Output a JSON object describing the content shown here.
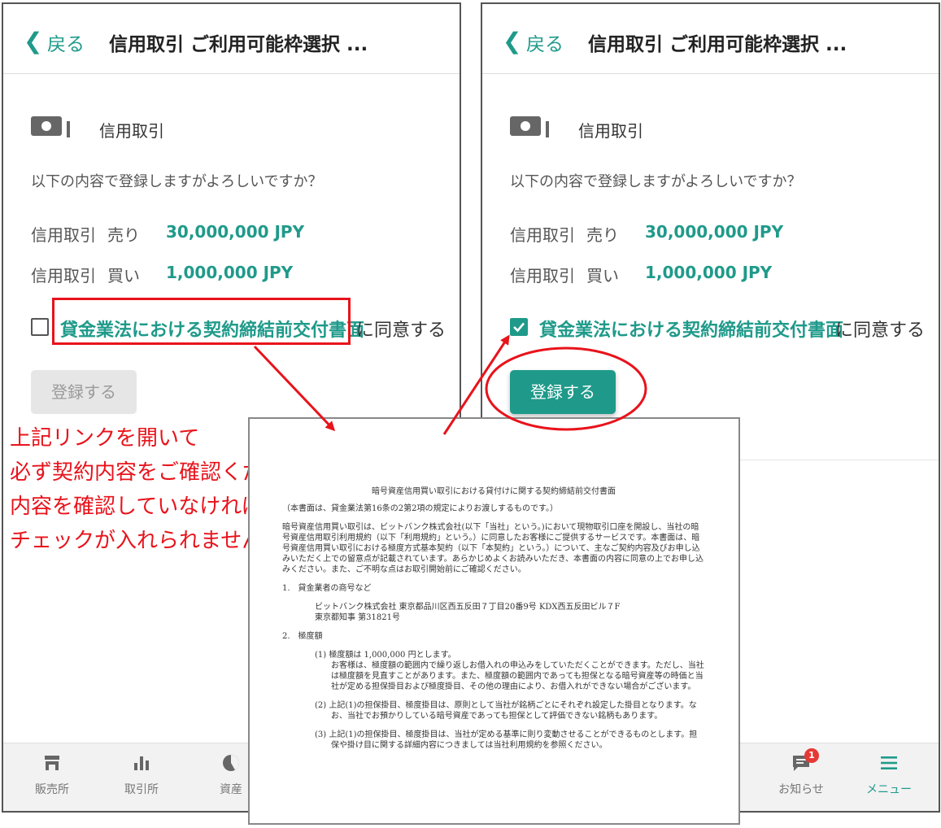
{
  "header": {
    "back_label": "戻る",
    "title": "信用取引 ご利用可能枠選択 ..."
  },
  "section": {
    "label": "信用取引",
    "icon": "cash-icon"
  },
  "confirm_text": "以下の内容で登録しますがよろしいですか？",
  "lines": {
    "sell_label": "信用取引",
    "sell_side": "売り",
    "sell_value": "30,000,000 JPY",
    "buy_label": "信用取引",
    "buy_side": "買い",
    "buy_value": "1,000,000 JPY"
  },
  "agreement": {
    "link_text": "貸金業法における契約締結前交付書面",
    "suffix": "に同意する"
  },
  "register_button": "登録する",
  "left_screen": {
    "checkbox_checked": false,
    "button_enabled": false
  },
  "right_screen": {
    "checkbox_checked": true,
    "button_enabled": true
  },
  "tabbar": {
    "left": [
      {
        "label": "販売所",
        "icon": "store-icon"
      },
      {
        "label": "取引所",
        "icon": "bar-chart-icon"
      },
      {
        "label": "資産",
        "icon": "pie-chart-icon"
      }
    ],
    "right": [
      {
        "label": "お知らせ",
        "icon": "notification-icon",
        "badge": "1"
      },
      {
        "label": "メニュー",
        "icon": "menu-icon"
      }
    ]
  },
  "annotation": {
    "line1": "上記リンクを開いて",
    "line2": "必ず契約内容をご確認ください",
    "line3": "内容を確認していなければ",
    "line4": "チェックが入れられません"
  },
  "document": {
    "title": "暗号資産信用買い取引における貸付けに関する契約締結前交付書面",
    "note": "（本書面は、貸金業法第16条の2第2項の規定によりお渡しするものです。）",
    "intro": "暗号資産信用買い取引は、ビットバンク株式会社(以下「当社」という。)において現物取引口座を開設し、当社の暗号資産信用取引利用規約（以下「利用規約」という。）に同意したお客様にご提供するサービスです。本書面は、暗号資産信用買い取引における極度方式基本契約（以下「本契約」という。）について、主なご契約内容及びお申し込みいただく上での留意点が記載されています。あらかじめよくお読みいただき、本書面の内容に同意の上でお申し込みください。また、ご不明な点はお取引開始前にご確認ください。",
    "s1_heading": "1.　貸金業者の商号など",
    "s1_line1": "ビットバンク株式会社 東京都品川区西五反田７丁目20番9号 KDX西五反田ビル７F",
    "s1_line2": "東京都知事 第31821号",
    "s2_heading": "2.　極度額",
    "item1_head": "(1) 極度額は 1,000,000 円とします。",
    "item1_body": "お客様は、極度額の範囲内で繰り返しお借入れの申込みをしていただくことができます。ただし、当社は極度額を見直すことがあります。また、極度額の範囲内であっても担保となる暗号資産等の時価と当社が定める担保掛目および極度掛目、その他の理由により、お借入れができない場合がございます。",
    "item2": "(2) 上記(1)の担保掛目、極度掛目は、原則として当社が銘柄ごとにそれぞれ設定した掛目となります。なお、当社でお預かりしている暗号資産であっても担保として評価できない銘柄もあります。",
    "item3": "(3) 上記(1)の担保掛目、極度掛目は、当社が定める基準に則り変動させることができるものとします。担保や掛け目に関する詳細内容につきましては当社利用規約を参照ください。"
  },
  "colors": {
    "accent": "#1f9a8a",
    "annotation_red": "#e8131b",
    "disabled_button": "#e6e6e6"
  }
}
